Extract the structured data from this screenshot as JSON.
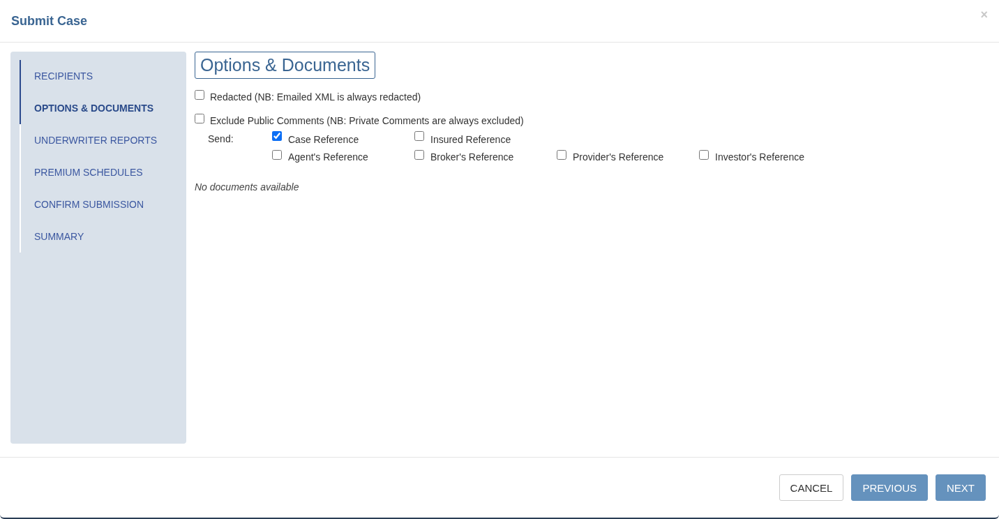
{
  "dialog": {
    "title": "Submit Case",
    "close": "×"
  },
  "steps": [
    {
      "label": "RECIPIENTS",
      "selected": false
    },
    {
      "label": "OPTIONS & DOCUMENTS",
      "selected": true
    },
    {
      "label": "UNDERWRITER REPORTS",
      "selected": false
    },
    {
      "label": "PREMIUM SCHEDULES",
      "selected": false
    },
    {
      "label": "CONFIRM SUBMISSION",
      "selected": false
    },
    {
      "label": "SUMMARY",
      "selected": false
    }
  ],
  "heading": "Options & Documents",
  "options": [
    {
      "label": "Redacted (NB: Emailed XML is always redacted)",
      "checked": false
    },
    {
      "label": "Exclude Public Comments (NB: Private Comments are always excluded)",
      "checked": false
    }
  ],
  "send": {
    "label": "Send:",
    "rows": [
      [
        {
          "label": "Case Reference",
          "checked": true
        },
        {
          "label": "Insured Reference",
          "checked": false
        }
      ],
      [
        {
          "label": "Agent's Reference",
          "checked": false
        },
        {
          "label": "Broker's Reference",
          "checked": false
        },
        {
          "label": "Provider's Reference",
          "checked": false
        },
        {
          "label": "Investor's Reference",
          "checked": false
        }
      ]
    ]
  },
  "documents_note": "No documents available",
  "buttons": [
    {
      "label": "CANCEL",
      "kind": "secondary"
    },
    {
      "label": "PREVIOUS",
      "kind": "primary"
    },
    {
      "label": "NEXT",
      "kind": "primary"
    }
  ]
}
